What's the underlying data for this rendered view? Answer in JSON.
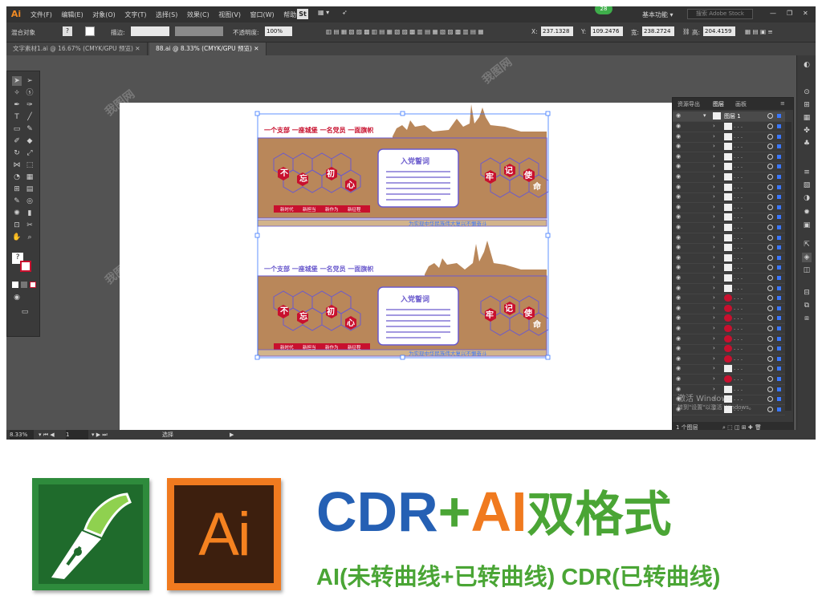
{
  "app": {
    "logo": "Ai",
    "menu": [
      "文件(F)",
      "编辑(E)",
      "对象(O)",
      "文字(T)",
      "选择(S)",
      "效果(C)",
      "视图(V)",
      "窗口(W)",
      "帮助(H)"
    ],
    "bridge_label": "St",
    "badge": "28",
    "workspace": "基本功能",
    "search_placeholder": "搜索 Adobe Stock"
  },
  "control": {
    "mixed_objects": "混合对象",
    "stroke_label": "描边:",
    "opacity_label": "不透明度:",
    "opacity_value": "100%",
    "x_label": "X:",
    "x_value": "237.1328",
    "y_label": "Y:",
    "y_value": "109.2476",
    "w_label": "宽:",
    "w_value": "238.2724",
    "h_label": "高:",
    "h_value": "204.4159"
  },
  "tabs": [
    {
      "label": "文字素材1.ai @ 16.67% (CMYK/GPU 预览)"
    },
    {
      "label": "88.ai @ 8.33% (CMYK/GPU 预览)"
    }
  ],
  "layers_panel": {
    "tabs": [
      "资源导出",
      "图层",
      "画板"
    ],
    "layer_name": "图层 1",
    "footer": "1 个图层"
  },
  "status": {
    "zoom": "8.33%",
    "page": "1",
    "mode": "选择"
  },
  "artwork": {
    "slogan_top": "一个支部 一座城堡 一名党员 一面旗帜",
    "slogan_bottom": "一个支部 一座城堡 一名党员 一面旗帜",
    "left_chars": [
      "不",
      "忘",
      "初",
      "心"
    ],
    "right_chars": [
      "牢",
      "记",
      "使",
      "命"
    ],
    "center_title": "入党誓词",
    "footer_tags": [
      "新时代",
      "新担当",
      "新作为",
      "新征程"
    ],
    "footer_banner": "为实现中华民族伟大复兴不懈奋斗",
    "wood_color": "#b9875a",
    "red_color": "#c8102e",
    "outline_color": "#6a5acd"
  },
  "watermark": "我图网",
  "activate_windows": "激活 Windows",
  "activate_settings": "转到\"设置\"以激活 Windows。",
  "promo": {
    "icon_ai_label": "Ai",
    "headline_cdr": "CDR",
    "headline_plus": "+",
    "headline_ai": "AI",
    "headline_cn": "双格式",
    "subline": "AI(未转曲线+已转曲线) CDR(已转曲线)",
    "cdr_color": "#2560b4",
    "ai_color": "#f07a1f",
    "green_color": "#4aa535"
  }
}
